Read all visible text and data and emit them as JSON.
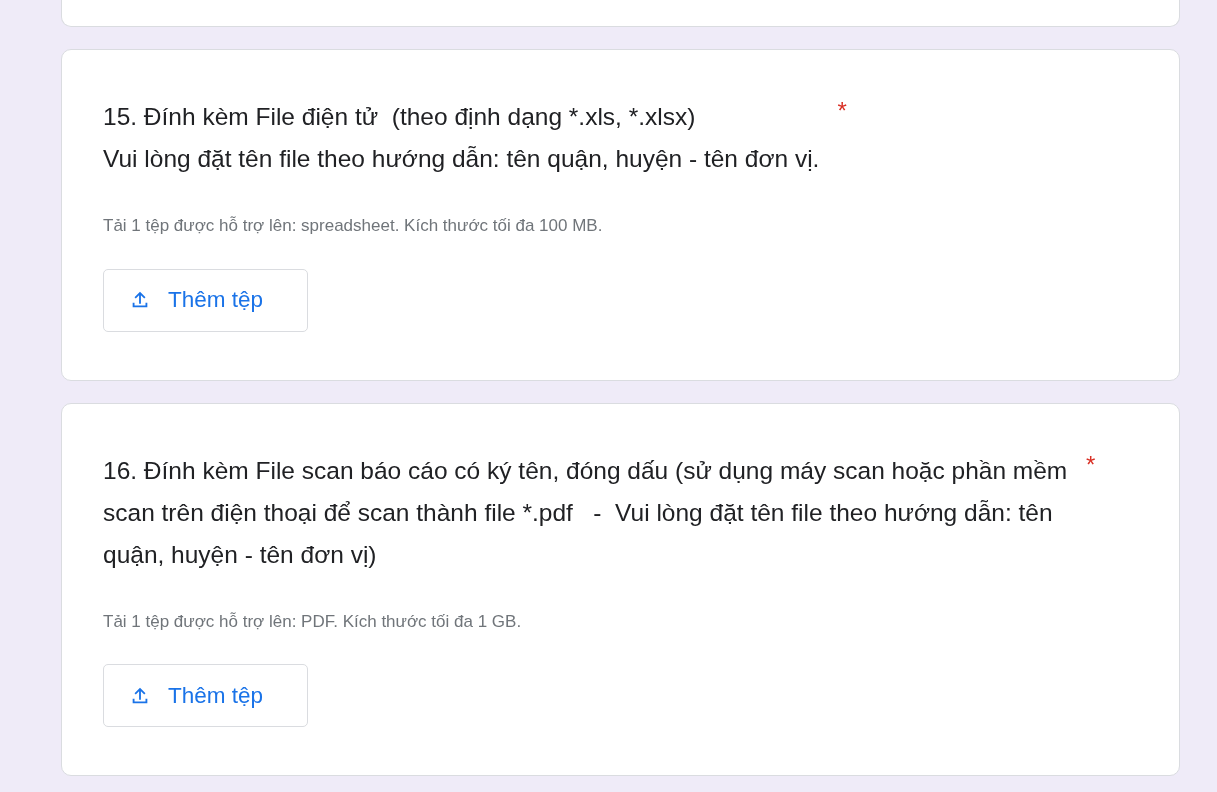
{
  "questions": [
    {
      "number_title": "15. Đính kèm File điện tử  (theo định dạng *.xls, *.xlsx)\nVui lòng đặt tên file theo hướng dẫn: tên quận, huyện - tên đơn vị.",
      "required": true,
      "required_mark": "*",
      "helper": "Tải 1 tệp được hỗ trợ lên: spreadsheet. Kích thước tối đa 100 MB.",
      "button": "Thêm tệp"
    },
    {
      "number_title": "16. Đính kèm File scan báo cáo có ký tên, đóng dấu (sử dụng máy scan hoặc phần mềm scan trên điện thoại để scan thành file *.pdf   -  Vui lòng đặt tên file theo hướng dẫn: tên quận, huyện - tên đơn vị)",
      "required": true,
      "required_mark": "*",
      "helper": "Tải 1 tệp được hỗ trợ lên: PDF. Kích thước tối đa 1 GB.",
      "button": "Thêm tệp"
    }
  ]
}
